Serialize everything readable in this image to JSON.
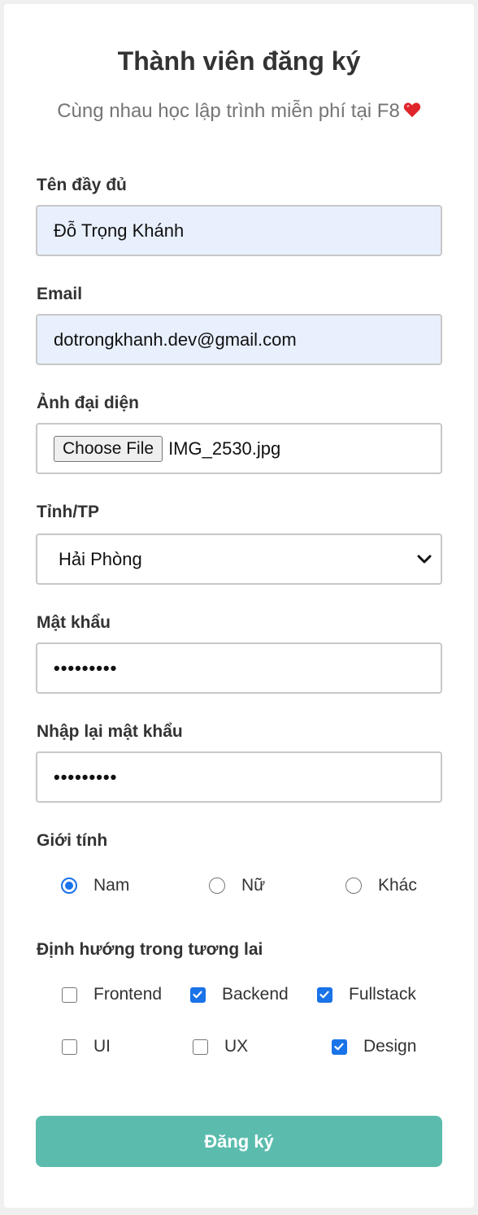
{
  "form": {
    "title": "Thành viên đăng ký",
    "subtitle": "Cùng nhau học lập trình miễn phí tại F8",
    "subtitle_icon": "heart-icon",
    "fullname": {
      "label": "Tên đầy đủ",
      "value": "Đỗ Trọng Khánh"
    },
    "email": {
      "label": "Email",
      "value": "dotrongkhanh.dev@gmail.com"
    },
    "avatar": {
      "label": "Ảnh đại diện",
      "button_label": "Choose File",
      "file_name": "IMG_2530.jpg"
    },
    "province": {
      "label": "Tỉnh/TP",
      "selected": "Hải Phòng"
    },
    "password": {
      "label": "Mật khẩu",
      "masked_value": "•••••••••"
    },
    "password_confirm": {
      "label": "Nhập lại mật khẩu",
      "masked_value": "•••••••••"
    },
    "gender": {
      "label": "Giới tính",
      "options": [
        {
          "label": "Nam",
          "checked": true
        },
        {
          "label": "Nữ",
          "checked": false
        },
        {
          "label": "Khác",
          "checked": false
        }
      ]
    },
    "orientation": {
      "label": "Định hướng trong tương lai",
      "options": [
        {
          "label": "Frontend",
          "checked": false
        },
        {
          "label": "Backend",
          "checked": true
        },
        {
          "label": "Fullstack",
          "checked": true
        },
        {
          "label": "UI",
          "checked": false
        },
        {
          "label": "UX",
          "checked": false
        },
        {
          "label": "Design",
          "checked": true
        }
      ]
    },
    "submit_label": "Đăng ký"
  },
  "colors": {
    "accent": "#1a73e8",
    "submit": "#5bbcae",
    "autofill": "#e8f0fe",
    "heart": "#e0242b"
  }
}
